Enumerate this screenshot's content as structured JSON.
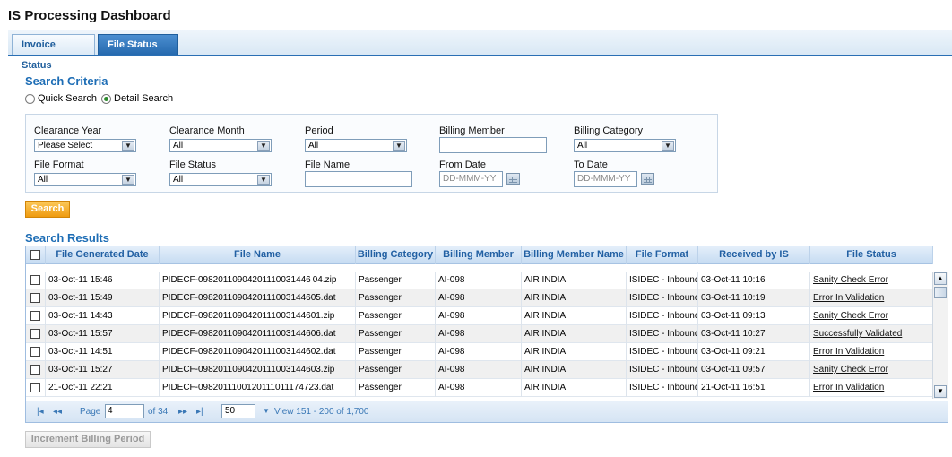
{
  "page_title": "IS Processing Dashboard",
  "tabs": [
    {
      "label": "Invoice Status",
      "active": false
    },
    {
      "label": "File Status",
      "active": true
    }
  ],
  "search_criteria": {
    "heading": "Search Criteria",
    "mode_quick": "Quick Search",
    "mode_detail": "Detail Search",
    "selected_mode": "Detail Search",
    "fields": {
      "clearance_year": {
        "label": "Clearance Year",
        "value": "Please Select"
      },
      "clearance_month": {
        "label": "Clearance Month",
        "value": "All"
      },
      "period": {
        "label": "Period",
        "value": "All"
      },
      "billing_member": {
        "label": "Billing Member",
        "value": ""
      },
      "billing_category": {
        "label": "Billing Category",
        "value": "All"
      },
      "file_format": {
        "label": "File Format",
        "value": "All"
      },
      "file_status": {
        "label": "File Status",
        "value": "All"
      },
      "file_name": {
        "label": "File Name",
        "value": ""
      },
      "from_date": {
        "label": "From Date",
        "placeholder": "DD-MMM-YY"
      },
      "to_date": {
        "label": "To Date",
        "placeholder": "DD-MMM-YY"
      }
    },
    "search_button": "Search"
  },
  "search_results": {
    "heading": "Search Results",
    "columns": [
      "File Generated Date",
      "File Name",
      "Billing Category",
      "Billing Member",
      "Billing Member Name",
      "File Format",
      "Received by IS",
      "File Status"
    ],
    "rows": [
      {
        "generated": "03-Oct-11 15:46",
        "file_name": "PIDECF-09820110904201110031446 04.zip",
        "category": "Passenger",
        "member": "AI-098",
        "member_name": "AIR INDIA",
        "format": "ISIDEC - Inbound",
        "received": "03-Oct-11 10:16",
        "status": "Sanity Check Error"
      },
      {
        "generated": "03-Oct-11 15:49",
        "file_name": "PIDECF-0982011090420111003144605.dat",
        "category": "Passenger",
        "member": "AI-098",
        "member_name": "AIR INDIA",
        "format": "ISIDEC - Inbound",
        "received": "03-Oct-11 10:19",
        "status": "Error In Validation"
      },
      {
        "generated": "03-Oct-11 14:43",
        "file_name": "PIDECF-0982011090420111003144601.zip",
        "category": "Passenger",
        "member": "AI-098",
        "member_name": "AIR INDIA",
        "format": "ISIDEC - Inbound",
        "received": "03-Oct-11 09:13",
        "status": "Sanity Check Error"
      },
      {
        "generated": "03-Oct-11 15:57",
        "file_name": "PIDECF-0982011090420111003144606.dat",
        "category": "Passenger",
        "member": "AI-098",
        "member_name": "AIR INDIA",
        "format": "ISIDEC - Inbound",
        "received": "03-Oct-11 10:27",
        "status": "Successfully Validated"
      },
      {
        "generated": "03-Oct-11 14:51",
        "file_name": "PIDECF-0982011090420111003144602.dat",
        "category": "Passenger",
        "member": "AI-098",
        "member_name": "AIR INDIA",
        "format": "ISIDEC - Inbound",
        "received": "03-Oct-11 09:21",
        "status": "Error In Validation"
      },
      {
        "generated": "03-Oct-11 15:27",
        "file_name": "PIDECF-0982011090420111003144603.zip",
        "category": "Passenger",
        "member": "AI-098",
        "member_name": "AIR INDIA",
        "format": "ISIDEC - Inbound",
        "received": "03-Oct-11 09:57",
        "status": "Sanity Check Error"
      },
      {
        "generated": "21-Oct-11 22:21",
        "file_name": "PIDECF-0982011100120111011174723.dat",
        "category": "Passenger",
        "member": "AI-098",
        "member_name": "AIR INDIA",
        "format": "ISIDEC - Inbound",
        "received": "21-Oct-11 16:51",
        "status": "Error In Validation"
      }
    ],
    "pager": {
      "page_label": "Page",
      "current_page": "4",
      "of_pages": "of 34",
      "page_size": "50",
      "view_text": "View 151 - 200 of 1,700"
    }
  },
  "increment_button": "Increment Billing Period",
  "colors": {
    "accent": "#1d6db5",
    "tab_active": "#2468ad",
    "search_button": "#ef9b10"
  }
}
